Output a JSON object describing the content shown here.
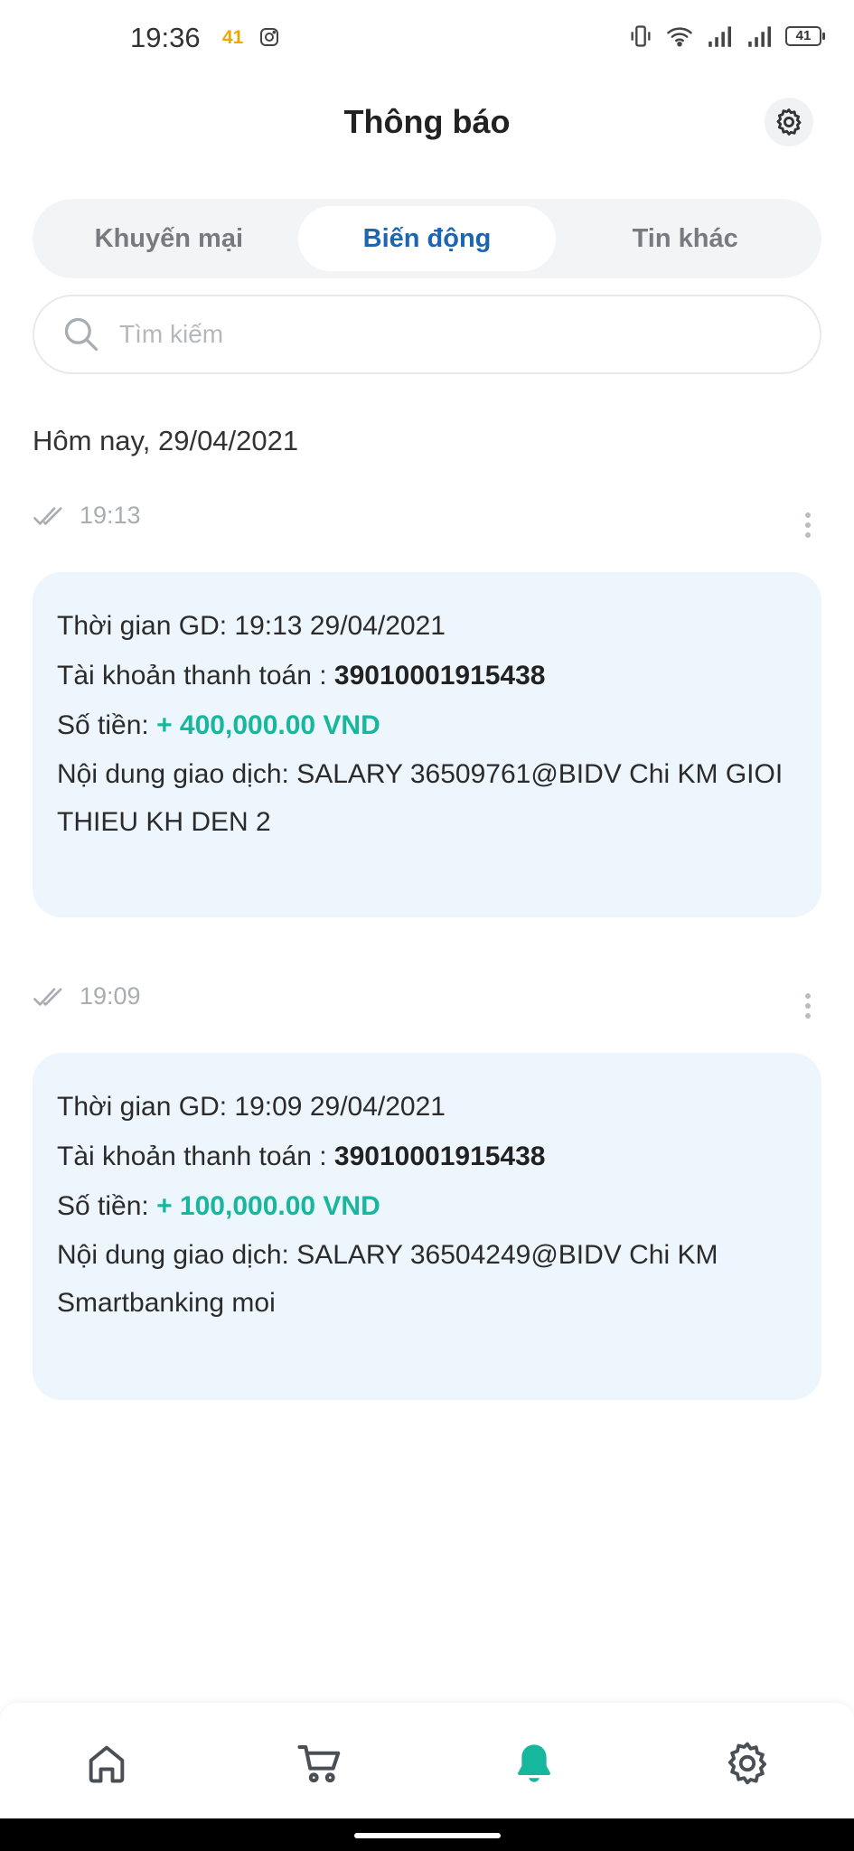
{
  "status_bar": {
    "time": "19:36",
    "notification_count": "41",
    "battery": "41"
  },
  "header": {
    "title": "Thông báo"
  },
  "tabs": [
    {
      "label": "Khuyến mại",
      "active": false
    },
    {
      "label": "Biến động",
      "active": true
    },
    {
      "label": "Tin khác",
      "active": false
    }
  ],
  "search": {
    "placeholder": "Tìm kiếm",
    "value": ""
  },
  "date_heading": "Hôm nay, 29/04/2021",
  "notifications": [
    {
      "time": "19:13",
      "gd_label": "Thời gian GD:",
      "gd_value": "19:13 29/04/2021",
      "account_label": "Tài khoản thanh toán :",
      "account": "39010001915438",
      "amount_label": "Số tiền:",
      "amount": "+ 400,000.00 VND",
      "desc_label": "Nội dung giao dịch:",
      "desc": "SALARY 36509761@BIDV Chi KM GIOI THIEU KH DEN 2"
    },
    {
      "time": "19:09",
      "gd_label": "Thời gian GD:",
      "gd_value": "19:09 29/04/2021",
      "account_label": "Tài khoản thanh toán :",
      "account": "39010001915438",
      "amount_label": "Số tiền:",
      "amount": "+ 100,000.00 VND",
      "desc_label": "Nội dung giao dịch:",
      "desc": "SALARY 36504249@BIDV Chi KM Smartbanking moi"
    }
  ],
  "bottom_nav": [
    {
      "icon": "home-icon",
      "active": false
    },
    {
      "icon": "cart-icon",
      "active": false
    },
    {
      "icon": "bell-icon",
      "active": true
    },
    {
      "icon": "settings-icon",
      "active": false
    }
  ],
  "colors": {
    "accent_blue": "#1c65b0",
    "accent_green": "#17b79e",
    "card_bg": "#eef6fd",
    "notification_badge": "#f0a800"
  }
}
